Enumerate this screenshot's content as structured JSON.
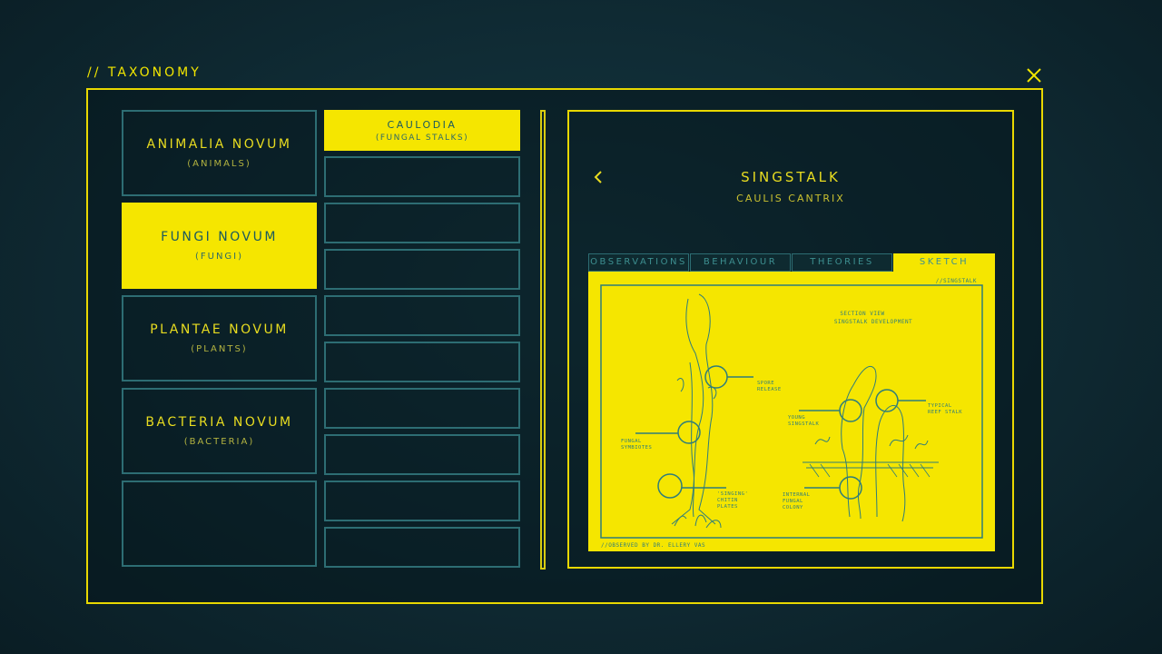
{
  "header": {
    "title": "// TAXONOMY"
  },
  "kingdoms": [
    {
      "name": "ANIMALIA NOVUM",
      "sub": "(ANIMALS)"
    },
    {
      "name": "FUNGI NOVUM",
      "sub": "(FUNGI)"
    },
    {
      "name": "PLANTAE NOVUM",
      "sub": "(PLANTS)"
    },
    {
      "name": "BACTERIA NOVUM",
      "sub": "(BACTERIA)"
    },
    {
      "name": "",
      "sub": ""
    }
  ],
  "subcategories": [
    {
      "name": "CAULODIA",
      "sub": "(FUNGAL STALKS)"
    }
  ],
  "detail": {
    "name": "SINGSTALK",
    "latin": "CAULIS CANTRIX",
    "tabs": [
      "OBSERVATIONS",
      "BEHAVIOUR",
      "THEORIES",
      "SKETCH"
    ],
    "active_tab": "SKETCH",
    "sketch": {
      "tag": "//SINGSTALK",
      "section_line1": "SECTION VIEW",
      "section_line2": "SINGSTALK DEVELOPMENT",
      "spore_line1": "SPORE",
      "spore_line2": "RELEASE",
      "symb_line1": "FUNGAL",
      "symb_line2": "SYMBIOTES",
      "singing_line1": "'SINGING'",
      "singing_line2": "CHITIN",
      "singing_line3": "PLATES",
      "young_line1": "YOUNG",
      "young_line2": "SINGSTALK",
      "typical_line1": "TYPICAL",
      "typical_line2": "REEF STALK",
      "internal_line1": "INTERNAL",
      "internal_line2": "FUNGAL",
      "internal_line3": "COLONY",
      "observer": "//OBSERVED BY DR. ELLERY VAS"
    }
  },
  "colors": {
    "accent": "#f5e600",
    "teal": "#2d6d73",
    "background": "#0f2a33"
  },
  "icons": {
    "close": "close-icon",
    "back": "chevron-left-icon"
  }
}
